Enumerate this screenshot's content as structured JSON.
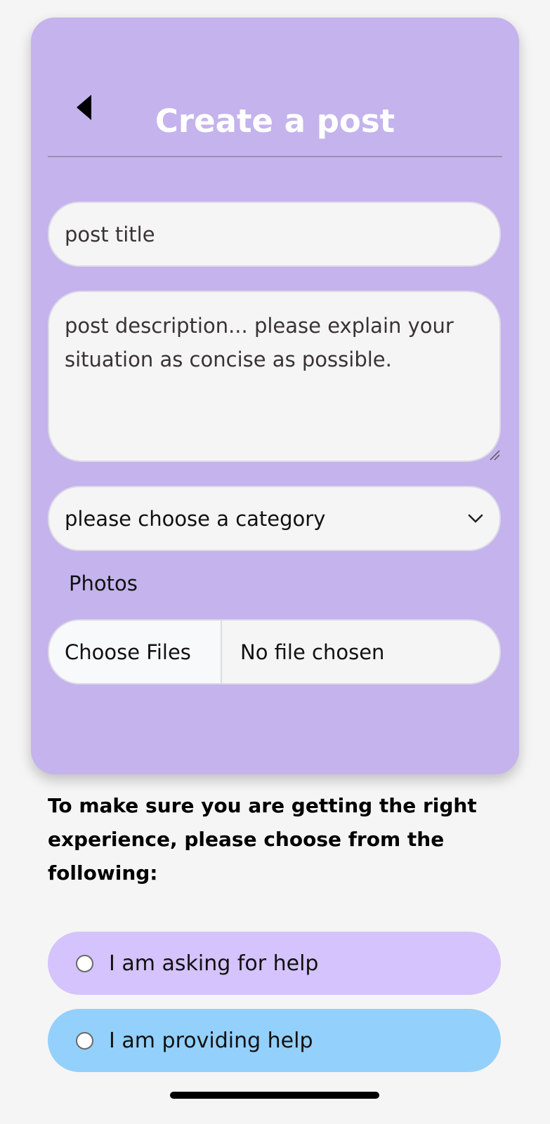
{
  "header": {
    "title": "Create a post",
    "back_icon": "caret-left-icon"
  },
  "form": {
    "title_placeholder": "post title",
    "description_placeholder": "post description... please explain your situation as concise as possible.",
    "category_selected": "please choose a category",
    "category_icon": "chevron-down-icon",
    "photos_label": "Photos",
    "choose_files_label": "Choose Files",
    "no_file_text": "No file chosen"
  },
  "experience": {
    "prompt": "To make sure you are getting the right experience, please choose from the following:",
    "options": [
      {
        "label": "I am asking for help",
        "color": "#d4c3fd"
      },
      {
        "label": "I am providing help",
        "color": "#94d0fc"
      }
    ]
  },
  "colors": {
    "card_background": "#c4b3ec",
    "field_background": "#f5f5f5",
    "title_text": "#ffffff"
  }
}
